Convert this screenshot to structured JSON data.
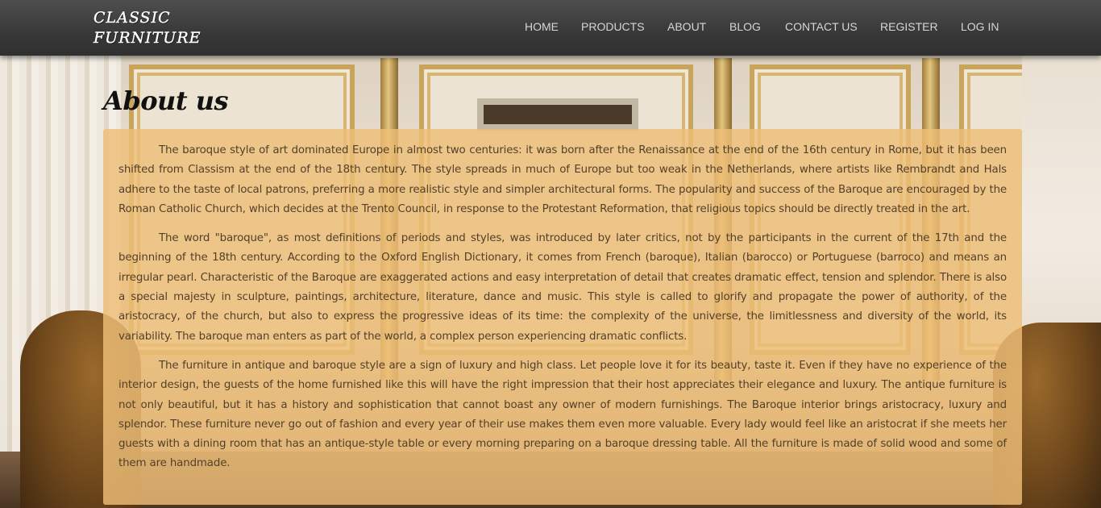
{
  "header": {
    "logo_line1": "CLASSIC",
    "logo_line2": "FURNITURE",
    "nav": [
      {
        "label": "HOME"
      },
      {
        "label": "PRODUCTS"
      },
      {
        "label": "ABOUT"
      },
      {
        "label": "BLOG"
      },
      {
        "label": "CONTACT US"
      },
      {
        "label": "REGISTER"
      },
      {
        "label": "LOG IN"
      }
    ]
  },
  "main": {
    "title": "About us",
    "paragraphs": [
      "The baroque style of art dominated Europe in almost two centuries: it was born after the Renaissance at the end of the 16th century in Rome, but it has been shifted from Classism at the end of the 18th century. The style spreads in much of Europe but too weak in the Netherlands, where artists like Rembrandt and Hals adhere to the taste of local patrons, preferring a more realistic style and simpler architectural forms. The popularity and success of the Baroque are encouraged by the Roman Catholic Church, which decides at the Trento Council, in response to the Protestant Reformation, that religious topics should be directly treated in the art.",
      "The word \"baroque\", as most definitions of periods and styles, was introduced by later critics, not by the participants in the current of the 17th and the beginning of the 18th century. According to the Oxford English Dictionary, it comes from French (baroque), Italian (barocco) or Portuguese (barroco) and means an irregular pearl. Characteristic of the Baroque are exaggerated actions and easy interpretation of detail that creates dramatic effect, tension and splendor. There is also a special majesty in sculpture, paintings, architecture, literature, dance and music. This style is called to glorify and propagate the power of authority, of the aristocracy, of the church, but also to express the progressive ideas of its time: the complexity of the universe, the limitlessness and diversity of the world, its variability. The baroque man enters as part of the world, a complex person experiencing dramatic conflicts.",
      "The furniture in antique and baroque style are a sign of luxury and high class. Let people love it for its beauty, taste it. Even if they have no experience of the interior design, the guests of the home furnished like this will have the right impression that their host appreciates their elegance and luxury. The antique furniture is not only beautiful, but it has a history and sophistication that cannot boast any owner of modern furnishings. The Baroque interior brings aristocracy, luxury and splendor. These furniture never go out of fashion and every year of their use makes them even more valuable. Every lady would feel like an aristocrat if she meets her guests with a dining room that has an antique-style table or every morning preparing on a baroque dressing table. All the furniture is made of solid wood and some of them are handmade."
    ]
  }
}
